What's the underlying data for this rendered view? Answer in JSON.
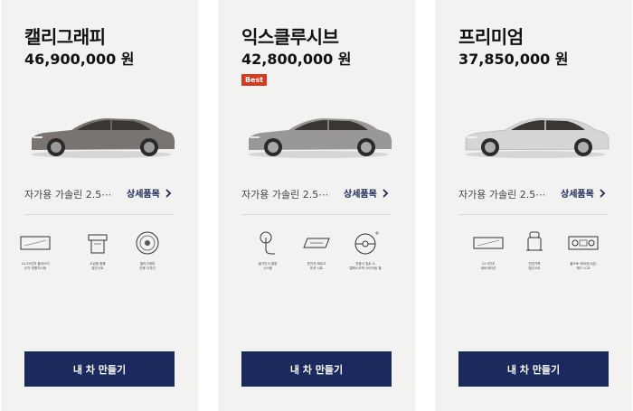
{
  "cards": [
    {
      "trim": "캘리그래피",
      "price": "46,900,000 원",
      "badge": "",
      "car_color": "#7a7470",
      "spec": "자가용 가솔린 2.5⋯",
      "detail_label": "상세품목",
      "features": [
        {
          "icon": "display-screen-icon",
          "label": "10.25인치 클러스터\n순차 방향지시등"
        },
        {
          "icon": "seat-heating-icon",
          "label": "고급형 통풍\n열선시트"
        },
        {
          "icon": "wheel-icon",
          "label": "캘리그래피\n전용 디자인"
        }
      ],
      "build_label": "내 차 만들기"
    },
    {
      "trim": "익스클루시브",
      "price": "42,800,000 원",
      "badge": "Best",
      "car_color": "#9a9896",
      "spec": "자가용 가솔린 2.5⋯",
      "detail_label": "상세품목",
      "features": [
        {
          "icon": "touch-control-icon",
          "label": "필기인식 통합\n시스템"
        },
        {
          "icon": "massage-seat-icon",
          "label": "운전석 에르고\n모션 시트"
        },
        {
          "icon": "steering-wheel-icon",
          "label": "전동식 틸트 &\n텔레스코픽 스티어링 휠"
        }
      ],
      "build_label": "내 차 만들기"
    },
    {
      "trim": "프리미엄",
      "price": "37,850,000 원",
      "badge": "",
      "car_color": "#cfd0d2",
      "spec": "자가용 가솔린 2.5⋯",
      "detail_label": "상세품목",
      "features": [
        {
          "icon": "display-screen-icon",
          "label": "12.3인치\n내비게이션"
        },
        {
          "icon": "seat-icon",
          "label": "천연가죽\n열선시트"
        },
        {
          "icon": "climate-panel-icon",
          "label": "풀오토 에어컨(3존)\n헤드 LCD"
        }
      ],
      "build_label": "내 차 만들기"
    }
  ]
}
